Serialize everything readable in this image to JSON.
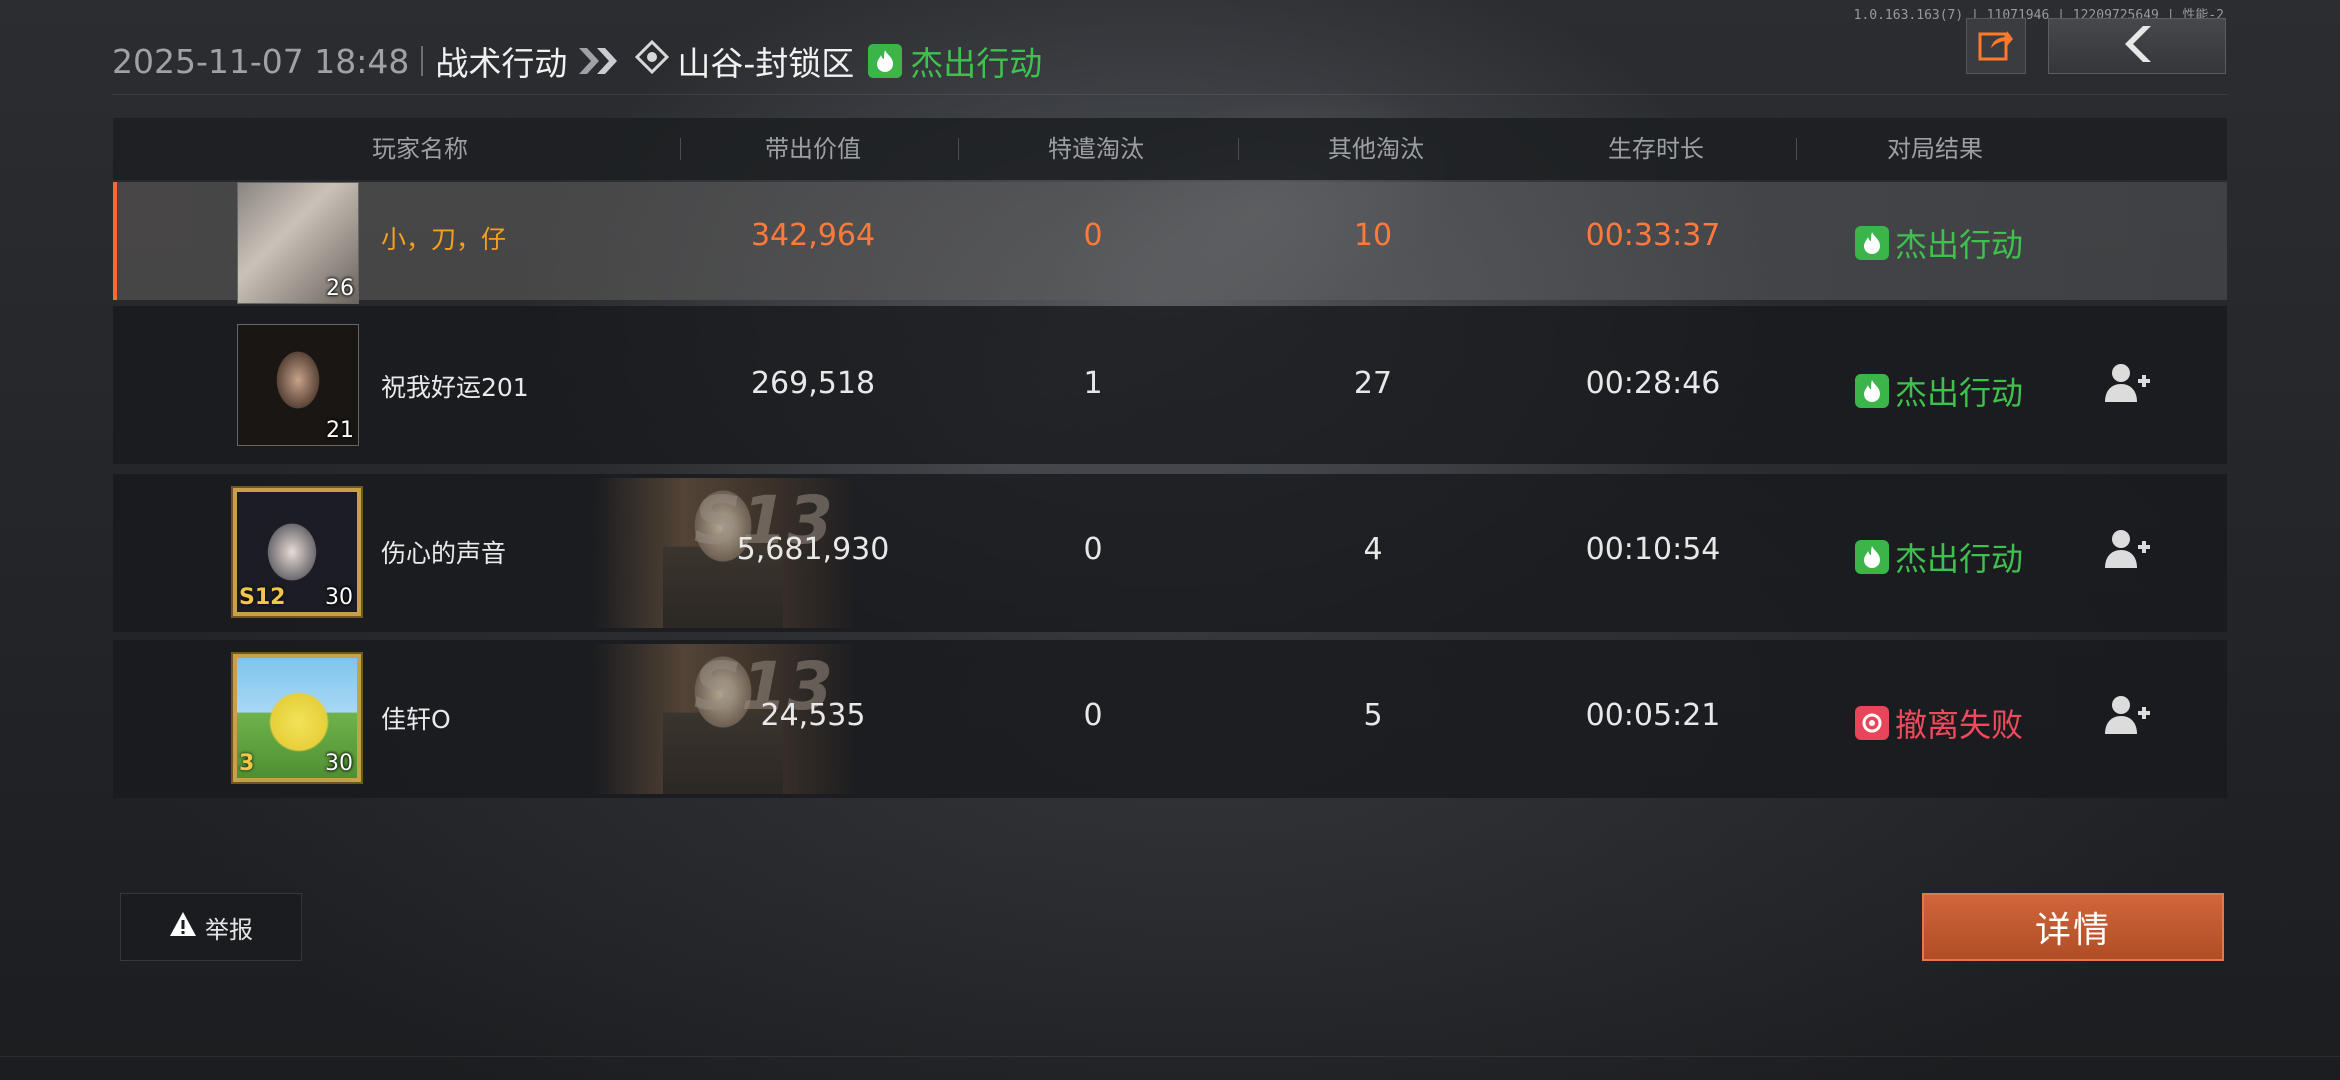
{
  "debug_info": "1.0.163.163(7) | 11071946 | 12209725649 | 性能-2",
  "header": {
    "datetime": "2025-11-07 18:48",
    "mode": "战术行动",
    "map": "山谷-封锁区",
    "result": "杰出行动"
  },
  "columns": [
    "玩家名称",
    "带出价值",
    "特遣淘汰",
    "其他淘汰",
    "生存时长",
    "对局结果"
  ],
  "players": [
    {
      "name": "小，刀，仔",
      "level": "26",
      "value": "342,964",
      "special_kills": "0",
      "other_kills": "10",
      "survival": "00:33:37",
      "result": "杰出行动",
      "result_status": "success",
      "self": true
    },
    {
      "name": "祝我好运201",
      "level": "21",
      "value": "269,518",
      "special_kills": "1",
      "other_kills": "27",
      "survival": "00:28:46",
      "result": "杰出行动",
      "result_status": "success"
    },
    {
      "name": "伤心的声音",
      "level": "30",
      "season": "S12",
      "skin_season": "S13",
      "value": "5,681,930",
      "special_kills": "0",
      "other_kills": "4",
      "survival": "00:10:54",
      "result": "杰出行动",
      "result_status": "success"
    },
    {
      "name": "佳轩O",
      "level": "30",
      "season": "3",
      "skin_season": "S13",
      "value": "24,535",
      "special_kills": "0",
      "other_kills": "5",
      "survival": "00:05:21",
      "result": "撤离失败",
      "result_status": "fail"
    }
  ],
  "buttons": {
    "report": "举报",
    "details": "详情"
  },
  "colors": {
    "accent": "#ff6a2a",
    "success": "#3fc24d",
    "fail": "#f04a5c",
    "details_button": "#c3592f"
  },
  "icons": [
    "share-icon",
    "back-arrow-icon",
    "double-chevron-icon",
    "map-diamond-icon",
    "flame-badge-icon",
    "add-friend-icon",
    "warning-icon"
  ]
}
